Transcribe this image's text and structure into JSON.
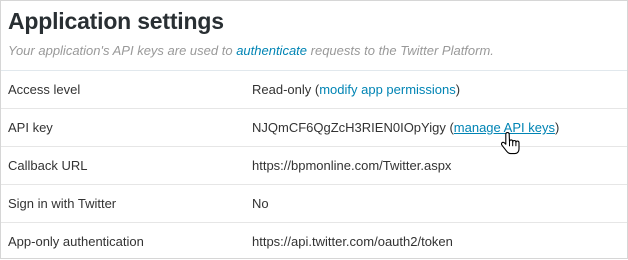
{
  "header": {
    "title": "Application settings",
    "subtitle_before": "Your application's API keys are used to ",
    "subtitle_link": "authenticate",
    "subtitle_after": " requests to the Twitter Platform."
  },
  "settings": [
    {
      "label": "Access level",
      "value_text": "Read-only (",
      "link_label": "modify app permissions",
      "value_suffix": ")"
    },
    {
      "label": "API key",
      "value_text": "NJQmCF6QgZcH3RIEN0IOpYigy (",
      "link_label": "manage API keys",
      "value_suffix": ")"
    },
    {
      "label": "Callback URL",
      "value_text": "https://bpmonline.com/Twitter.aspx"
    },
    {
      "label": "Sign in with Twitter",
      "value_text": "No"
    },
    {
      "label": "App-only authentication",
      "value_text": "https://api.twitter.com/oauth2/token"
    }
  ],
  "colors": {
    "link": "#0084b4",
    "title": "#292f33",
    "subtitle": "#999999",
    "text": "#333333"
  },
  "cursor": {
    "icon": "hand-pointer-icon"
  }
}
